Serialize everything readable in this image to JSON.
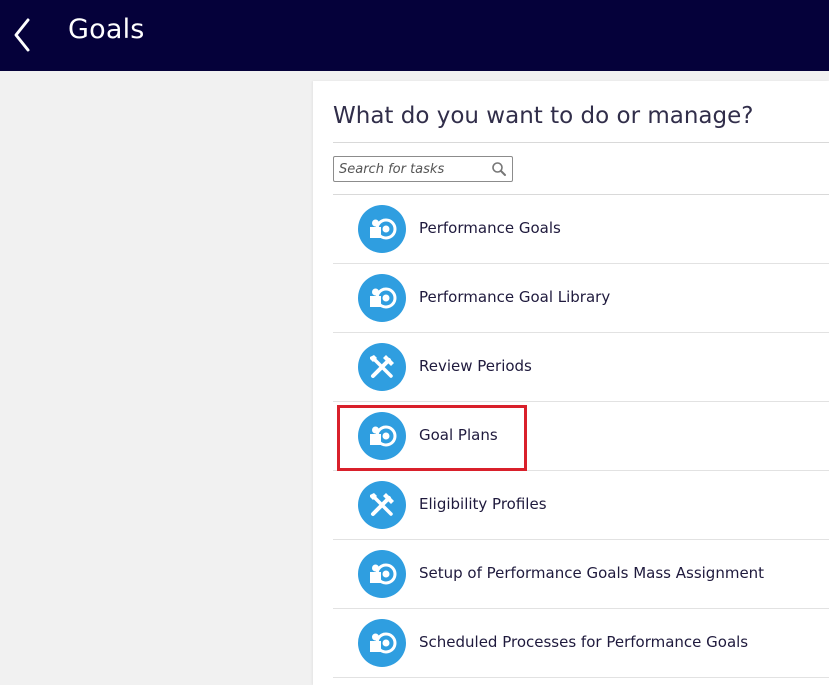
{
  "header": {
    "title": "Goals",
    "background_color": "#05013a"
  },
  "panel": {
    "title": "What do you want to do or manage?"
  },
  "search": {
    "placeholder": "Search for tasks",
    "value": ""
  },
  "tasks": [
    {
      "label": "Performance Goals",
      "icon": "goal-target-icon"
    },
    {
      "label": "Performance Goal Library",
      "icon": "goal-target-icon"
    },
    {
      "label": "Review Periods",
      "icon": "tools-icon"
    },
    {
      "label": "Goal Plans",
      "icon": "goal-target-icon",
      "highlighted": true
    },
    {
      "label": "Eligibility Profiles",
      "icon": "tools-icon"
    },
    {
      "label": "Setup of Performance Goals Mass Assignment",
      "icon": "goal-target-icon"
    },
    {
      "label": "Scheduled Processes for Performance Goals",
      "icon": "goal-target-icon"
    }
  ],
  "colors": {
    "icon_circle": "#2f9ee0",
    "highlight": "#d9202b"
  }
}
